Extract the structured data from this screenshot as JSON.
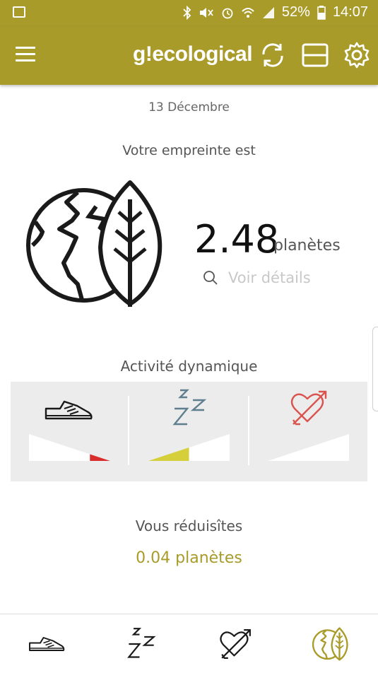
{
  "status_bar": {
    "battery": "52%",
    "time": "14:07"
  },
  "app_bar": {
    "brand": "g!ecological",
    "icons": [
      "menu-icon",
      "sync-icon",
      "card-icon",
      "settings-icon"
    ]
  },
  "header": {
    "date": "13  Décembre"
  },
  "footprint": {
    "label": "Votre empreinte est",
    "value": "2.48",
    "unit": "planètes",
    "details_link": "Voir détails"
  },
  "activity": {
    "title": "Activité dynamique",
    "items": [
      {
        "icon": "sneaker-icon",
        "fill_fraction": 0.25,
        "color": "#d92d2d"
      },
      {
        "icon": "sleep-icon",
        "fill_fraction": 0.5,
        "color": "#d4cf3a"
      },
      {
        "icon": "heart-arrow-icon",
        "fill_fraction": 0.0,
        "color": "#d9534f"
      }
    ]
  },
  "reduction": {
    "label": "Vous réduisîtes",
    "value": "0.04 planètes"
  },
  "bottom_nav": {
    "items": [
      "sneaker-icon",
      "sleep-icon",
      "heart-arrow-icon",
      "earth-leaf-icon"
    ],
    "active_index": 3
  },
  "colors": {
    "accent": "#a99b2a",
    "panel": "#ececec"
  }
}
